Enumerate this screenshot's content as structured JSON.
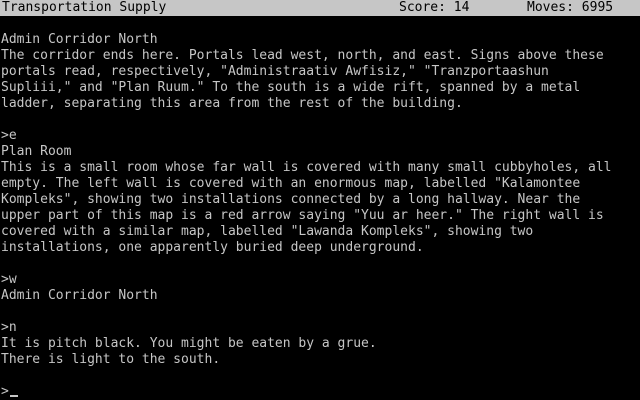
{
  "status_bar": {
    "location": "Transportation Supply",
    "score": "Score: 14",
    "moves": "Moves: 6995"
  },
  "transcript": [
    "Admin Corridor North",
    "The corridor ends here. Portals lead west, north, and east. Signs above these",
    "portals read, respectively, \"Administraativ Awfisiz,\" \"Tranzportaashun",
    "Supliii,\" and \"Plan Ruum.\" To the south is a wide rift, spanned by a metal",
    "ladder, separating this area from the rest of the building.",
    "",
    ">e",
    "Plan Room",
    "This is a small room whose far wall is covered with many small cubbyholes, all",
    "empty. The left wall is covered with an enormous map, labelled \"Kalamontee",
    "Kompleks\", showing two installations connected by a long hallway. Near the",
    "upper part of this map is a red arrow saying \"Yuu ar heer.\" The right wall is",
    "covered with a similar map, labelled \"Lawanda Kompleks\", showing two",
    "installations, one apparently buried deep underground.",
    "",
    ">w",
    "Admin Corridor North",
    "",
    ">n",
    "It is pitch black. You might be eaten by a grue.",
    "There is light to the south."
  ],
  "prompt": {
    "symbol": ">",
    "input_value": ""
  },
  "colors": {
    "background": "#000000",
    "text": "#c6c6c6",
    "status_bar_background": "#c6c6c6",
    "status_bar_text": "#000000"
  }
}
